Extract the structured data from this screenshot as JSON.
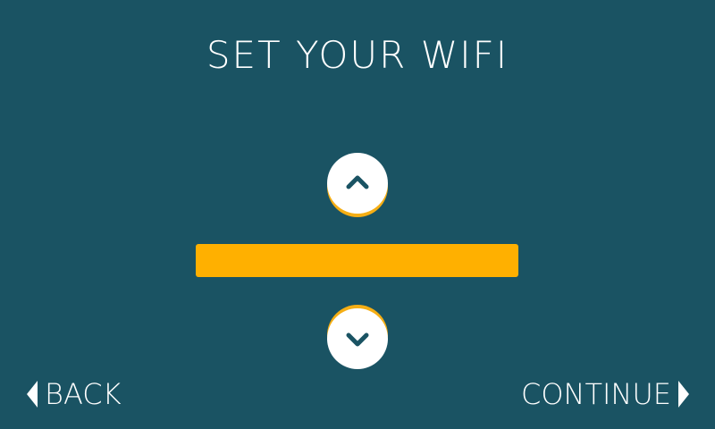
{
  "screen": {
    "title": "SET YOUR WIFI"
  },
  "selector": {
    "up_icon": "chevron-up-icon",
    "down_icon": "chevron-down-icon",
    "current_value": ""
  },
  "navigation": {
    "back_label": "BACK",
    "continue_label": "CONTINUE",
    "back_icon": "triangle-left-icon",
    "continue_icon": "triangle-right-icon"
  },
  "colors": {
    "background": "#1a5363",
    "accent": "#ffb000",
    "button_fill": "#ffffff",
    "text": "#ffffff"
  }
}
